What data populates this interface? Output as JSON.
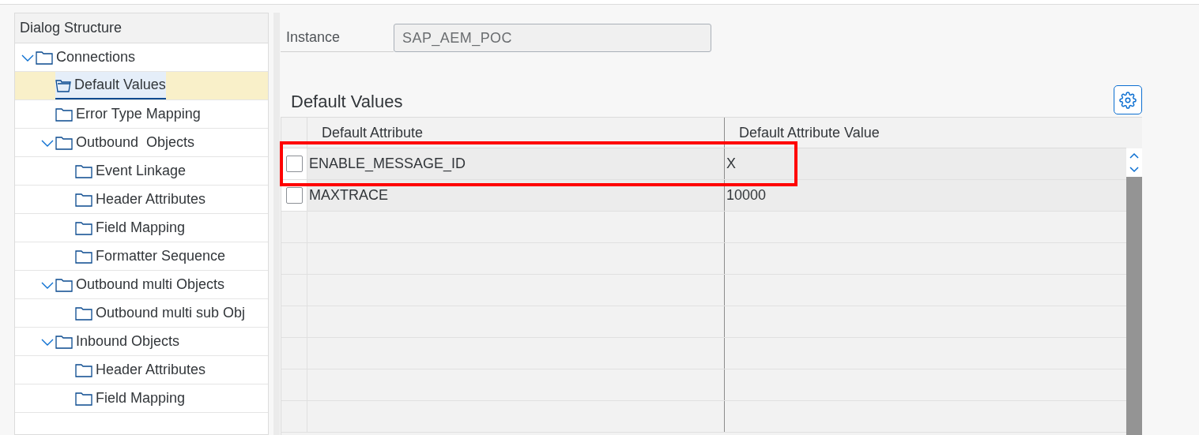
{
  "sidebar": {
    "title": "Dialog Structure",
    "tree": [
      {
        "label": "Connections",
        "expanded": true,
        "selected": false,
        "children": [
          {
            "label": "Default Values",
            "selected": true
          },
          {
            "label": "Error Type Mapping",
            "selected": false
          },
          {
            "label": "Outbound  Objects",
            "expanded": true,
            "selected": false,
            "children": [
              {
                "label": "Event Linkage",
                "selected": false
              },
              {
                "label": "Header Attributes",
                "selected": false
              },
              {
                "label": "Field Mapping",
                "selected": false
              },
              {
                "label": "Formatter Sequence",
                "selected": false
              }
            ]
          },
          {
            "label": "Outbound multi Objects",
            "expanded": true,
            "selected": false,
            "children": [
              {
                "label": "Outbound multi sub Obj",
                "selected": false
              }
            ]
          },
          {
            "label": "Inbound Objects",
            "expanded": true,
            "selected": false,
            "children": [
              {
                "label": "Header Attributes",
                "selected": false
              },
              {
                "label": "Field Mapping",
                "selected": false
              }
            ]
          }
        ]
      }
    ]
  },
  "instance": {
    "label": "Instance",
    "value": "SAP_AEM_POC"
  },
  "section_title": "Default Values",
  "table": {
    "columns": [
      "Default Attribute",
      "Default Attribute Value"
    ],
    "rows": [
      {
        "cells": [
          "ENABLE_MESSAGE_ID",
          "X"
        ],
        "checked": false,
        "highlighted": true
      },
      {
        "cells": [
          "MAXTRACE",
          "10000"
        ],
        "checked": false,
        "highlighted": false
      }
    ]
  }
}
